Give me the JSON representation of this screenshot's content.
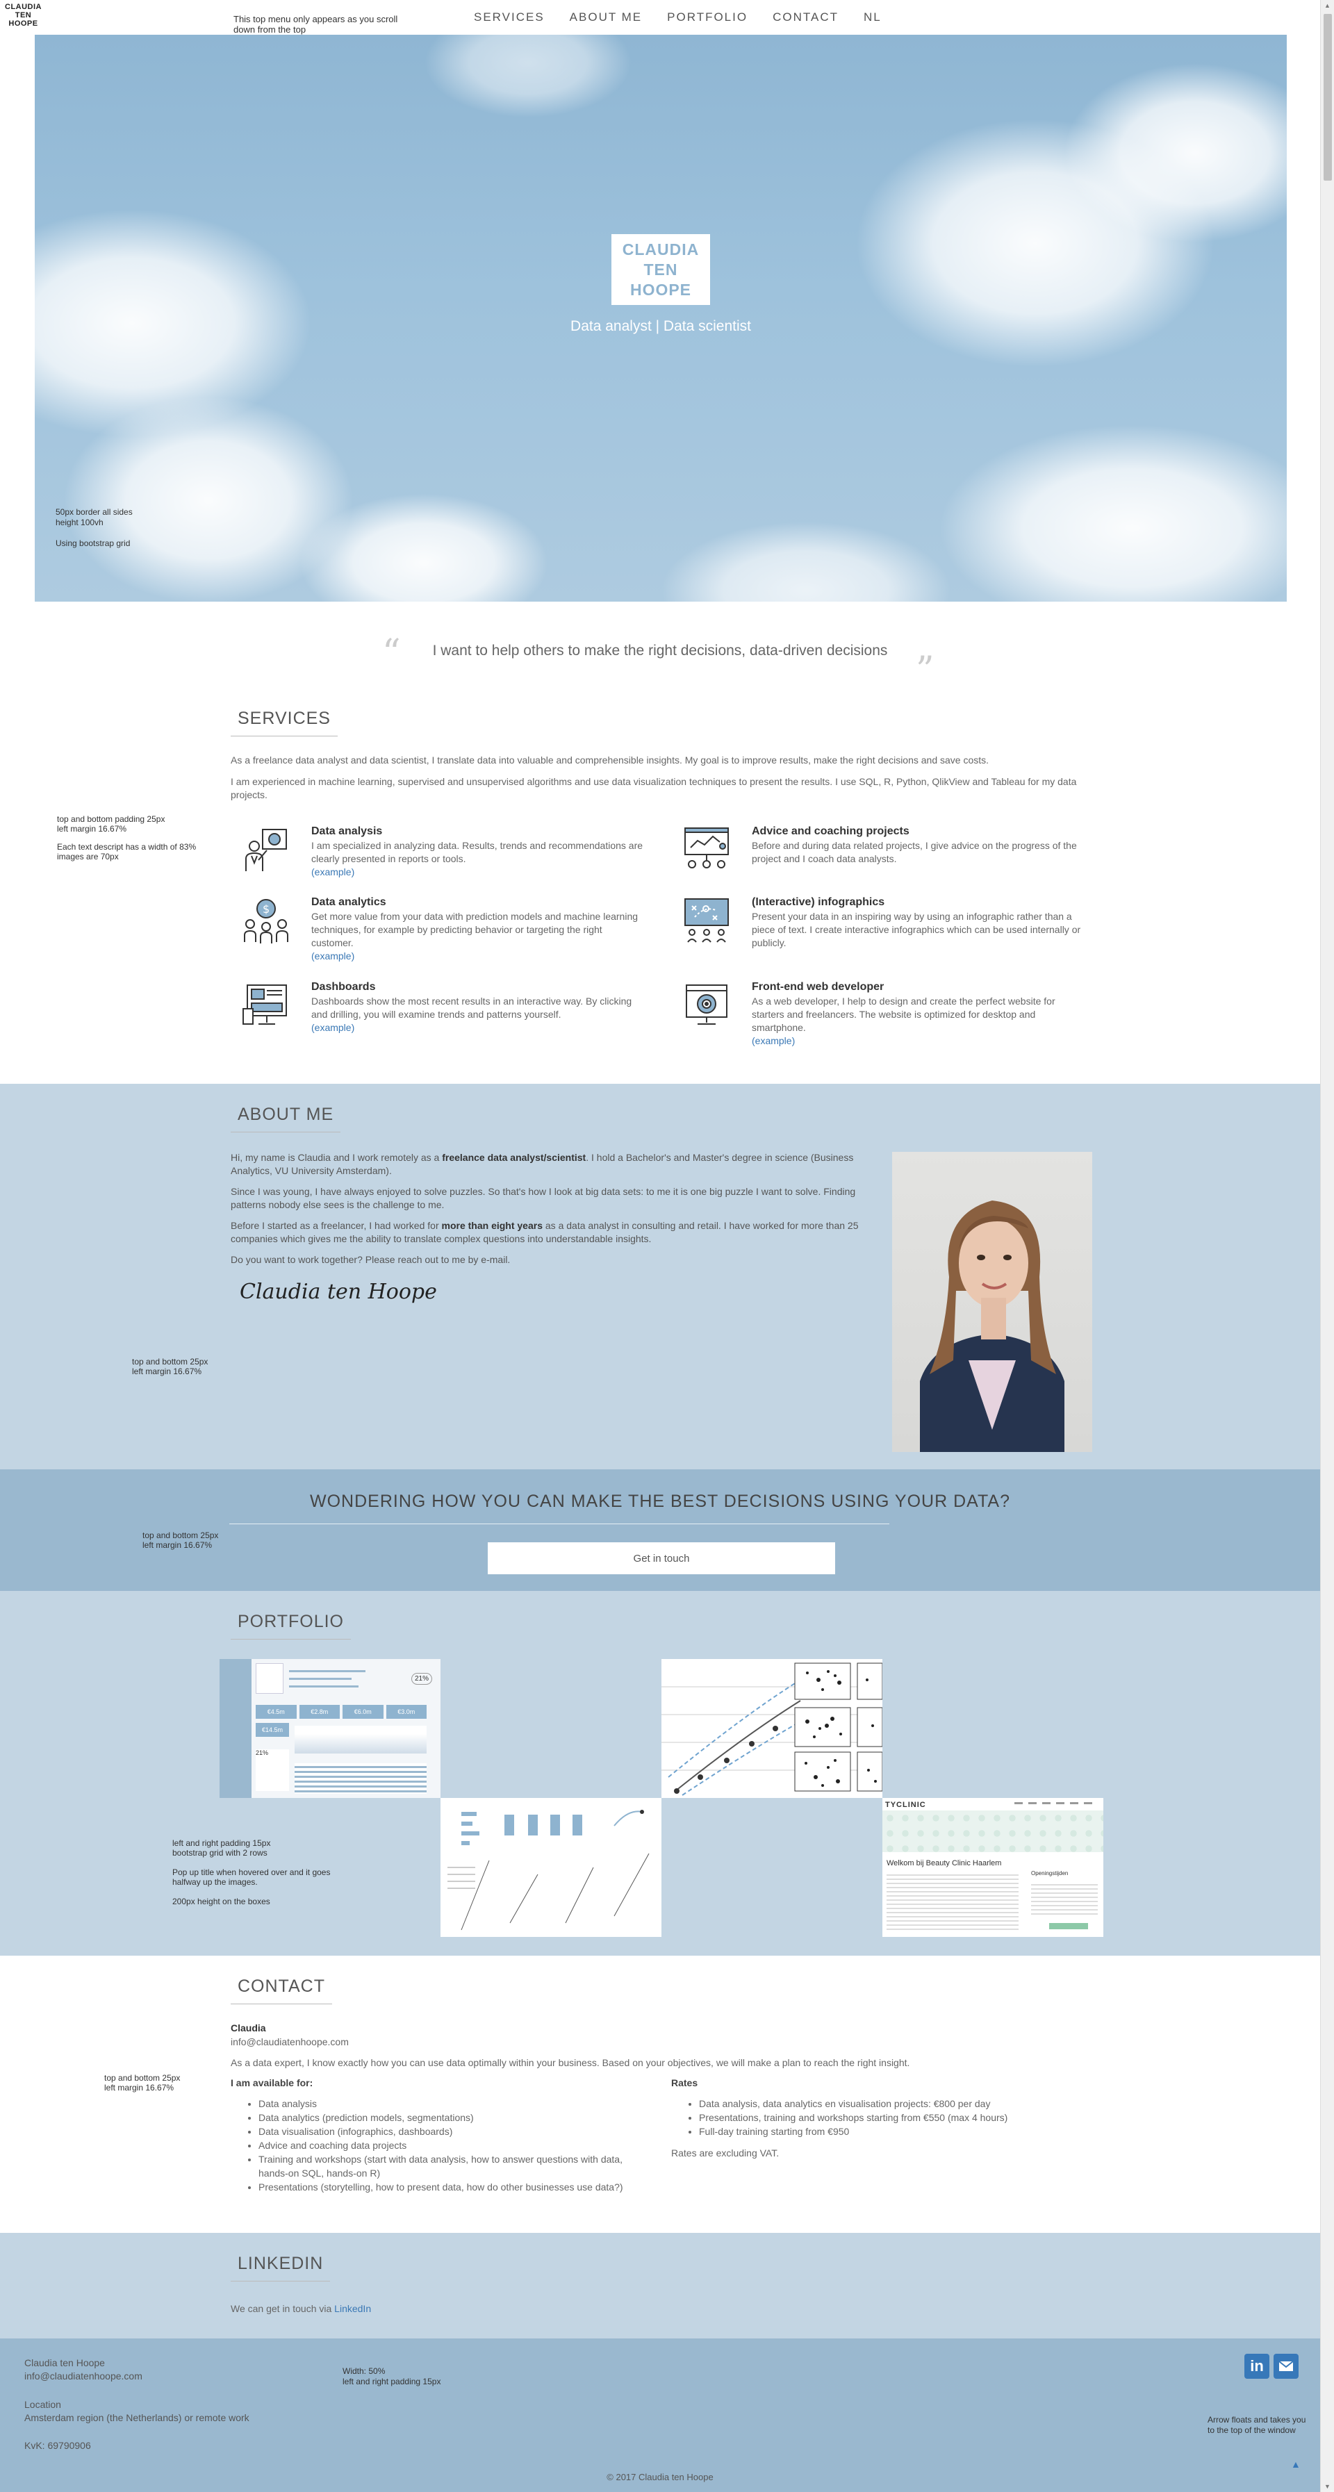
{
  "header": {
    "logo": [
      "CLAUDIA",
      "TEN",
      "HOOPE"
    ],
    "note": "This top menu only appears as you scroll down from the top",
    "nav": [
      "SERVICES",
      "ABOUT ME",
      "PORTFOLIO",
      "CONTACT",
      "NL"
    ]
  },
  "hero": {
    "logo": [
      "CLAUDIA",
      "TEN",
      "HOOPE"
    ],
    "subtitle": "Data analyst | Data scientist",
    "note": [
      "50px border all sides",
      "height 100vh",
      "Using bootstrap grid"
    ]
  },
  "quote": {
    "text": "I want to help others to make the right decisions, data-driven decisions"
  },
  "services": {
    "title": "SERVICES",
    "intro1": "As a freelance data analyst and data scientist, I translate data into valuable and comprehensible insights. My goal is to improve results, make the right decisions and save costs.",
    "intro2": "I am experienced in machine learning, supervised and unsupervised algorithms and use data visualization techniques to present the results. I use SQL, R, Python, QlikView and Tableau for my data projects.",
    "note": [
      "top and bottom padding 25px",
      "left margin 16.67%",
      "Each text descript has a width of 83%",
      "images are 70px"
    ],
    "items": [
      {
        "title": "Data analysis",
        "desc": "I am specialized in analyzing data. Results, trends and recommendations are clearly presented in reports or tools.",
        "link": "(example)",
        "icon": "presenter-chart-icon"
      },
      {
        "title": "Advice and coaching projects",
        "desc": "Before and during data related projects, I give advice on the progress of the project and I coach data analysts.",
        "link": "",
        "icon": "whiteboard-icon"
      },
      {
        "title": "Data analytics",
        "desc": "Get more value from your data with prediction models and machine learning techniques, for example by predicting behavior or targeting the right customer.",
        "link": "(example)",
        "icon": "people-money-icon"
      },
      {
        "title": "(Interactive) infographics",
        "desc": "Present your data in an inspiring way by using an infographic rather than a piece of text. I create interactive infographics which can be used internally or publicly.",
        "link": "",
        "icon": "strategy-board-icon"
      },
      {
        "title": "Dashboards",
        "desc": "Dashboards show the most recent results in an interactive way. By clicking and drilling, you will examine trends and patterns yourself.",
        "link": "(example)",
        "icon": "dashboard-icon"
      },
      {
        "title": "Front-end web developer",
        "desc": "As a web developer, I help to design and create the perfect website for starters and freelancers. The website is optimized for desktop and smartphone.",
        "link": "(example)",
        "icon": "monitor-target-icon"
      }
    ]
  },
  "about": {
    "title": "ABOUT ME",
    "p1_pre": "Hi, my name is Claudia and I work remotely as a ",
    "p1_bold": "freelance data analyst/scientist",
    "p1_post": ". I hold a Bachelor's and Master's degree in science (Business Analytics, VU University Amsterdam).",
    "p2": "Since I was young, I have always enjoyed to solve puzzles. So that's how I look at big data sets: to me it is one big puzzle I want to solve. Finding patterns nobody else sees is the challenge to me.",
    "p3_pre": "Before I started as a freelancer, I had worked for ",
    "p3_bold": "more than eight years",
    "p3_post": " as a data analyst in consulting and retail. I have worked for more than 25 companies which gives me the ability to translate complex questions into understandable insights.",
    "p4": "Do you want to work together? Please reach out to me by e-mail.",
    "signature": "Claudia ten Hoope",
    "note": [
      "top and bottom 25px",
      "left margin 16.67%"
    ]
  },
  "cta": {
    "title": "WONDERING HOW YOU CAN MAKE THE BEST DECISIONS USING YOUR DATA?",
    "button": "Get in touch",
    "note": [
      "top and bottom 25px",
      "left margin 16.67%"
    ]
  },
  "portfolio": {
    "title": "PORTFOLIO",
    "note": [
      "left and right padding 15px",
      "bootstrap grid with 2 rows",
      "Pop up title when hovered over and it goes halfway up the images.",
      "200px height on the boxes"
    ],
    "dash_values": [
      "€4.5m",
      "€2.8m",
      "€6.0m",
      "€3.0m",
      "€14.5m",
      "21%",
      "21%"
    ],
    "site": {
      "brand": "TYCLINIC",
      "heading": "Welkom bij Beauty Clinic Haarlem",
      "sidebar": "Openingstijden"
    }
  },
  "contact": {
    "title": "CONTACT",
    "name": "Claudia",
    "email": "info@claudiatenhoope.com",
    "intro": "As a data expert, I know exactly how you can use data optimally within your business. Based on your objectives, we will make a plan to reach the right insight.",
    "available_title": "I am available for:",
    "available": [
      "Data analysis",
      "Data analytics (prediction models, segmentations)",
      "Data visualisation (infographics, dashboards)",
      "Advice and coaching data projects",
      "Training and workshops (start with data analysis, how to answer questions with data, hands-on SQL, hands-on R)",
      "Presentations (storytelling, how to present data, how do other businesses use data?)"
    ],
    "rates_title": "Rates",
    "rates": [
      "Data analysis, data analytics en visualisation projects: €800 per day",
      "Presentations, training and workshops starting from €550 (max 4 hours)",
      "Full-day training starting from €950"
    ],
    "rates_note": "Rates are excluding VAT.",
    "note": [
      "top and bottom 25px",
      "left margin 16.67%"
    ]
  },
  "linkedin": {
    "title": "LINKEDIN",
    "text": "We can get in touch via ",
    "link": "LinkedIn"
  },
  "footer": {
    "name": "Claudia ten Hoope",
    "email": "info@claudiatenhoope.com",
    "location_label": "Location",
    "location": "Amsterdam region (the Netherlands) or remote work",
    "kvk": "KvK: 69790906",
    "width_note": [
      "Width: 50%",
      "left and right padding 15px"
    ],
    "arrow_note": "Arrow floats and takes you to the top of the window",
    "copyright": "© 2017 Claudia ten Hoope"
  }
}
